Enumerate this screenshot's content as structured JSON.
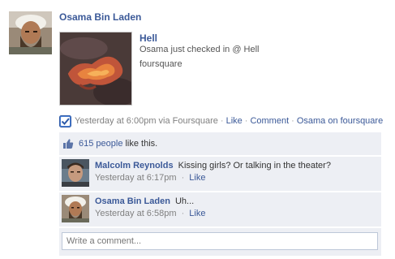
{
  "story": {
    "author": "Osama Bin Laden",
    "place": {
      "title": "Hell",
      "caption": "Osama just checked in @ Hell",
      "source": "foursquare"
    },
    "meta": {
      "timestamp": "Yesterday at 6:00pm via Foursquare",
      "like": "Like",
      "comment": "Comment",
      "attribution": "Osama  on foursquare",
      "separator": "·"
    }
  },
  "likes": {
    "count": "615 people",
    "suffix": "like this."
  },
  "comments": [
    {
      "author": "Malcolm Reynolds",
      "text": "Kissing girls?  Or talking in the theater?",
      "timestamp": "Yesterday at 6:17pm",
      "like": "Like"
    },
    {
      "author": "Osama Bin Laden",
      "text": "Uh...",
      "timestamp": "Yesterday at 6:58pm",
      "like": "Like"
    }
  ],
  "composer": {
    "placeholder": "Write a comment..."
  },
  "icons": {
    "foursquare": "foursquare-checkmark-icon",
    "like": "thumbs-up-icon"
  },
  "colors": {
    "link": "#3b5998",
    "feedback_bg": "#edeff4",
    "meta_text": "#808080"
  }
}
